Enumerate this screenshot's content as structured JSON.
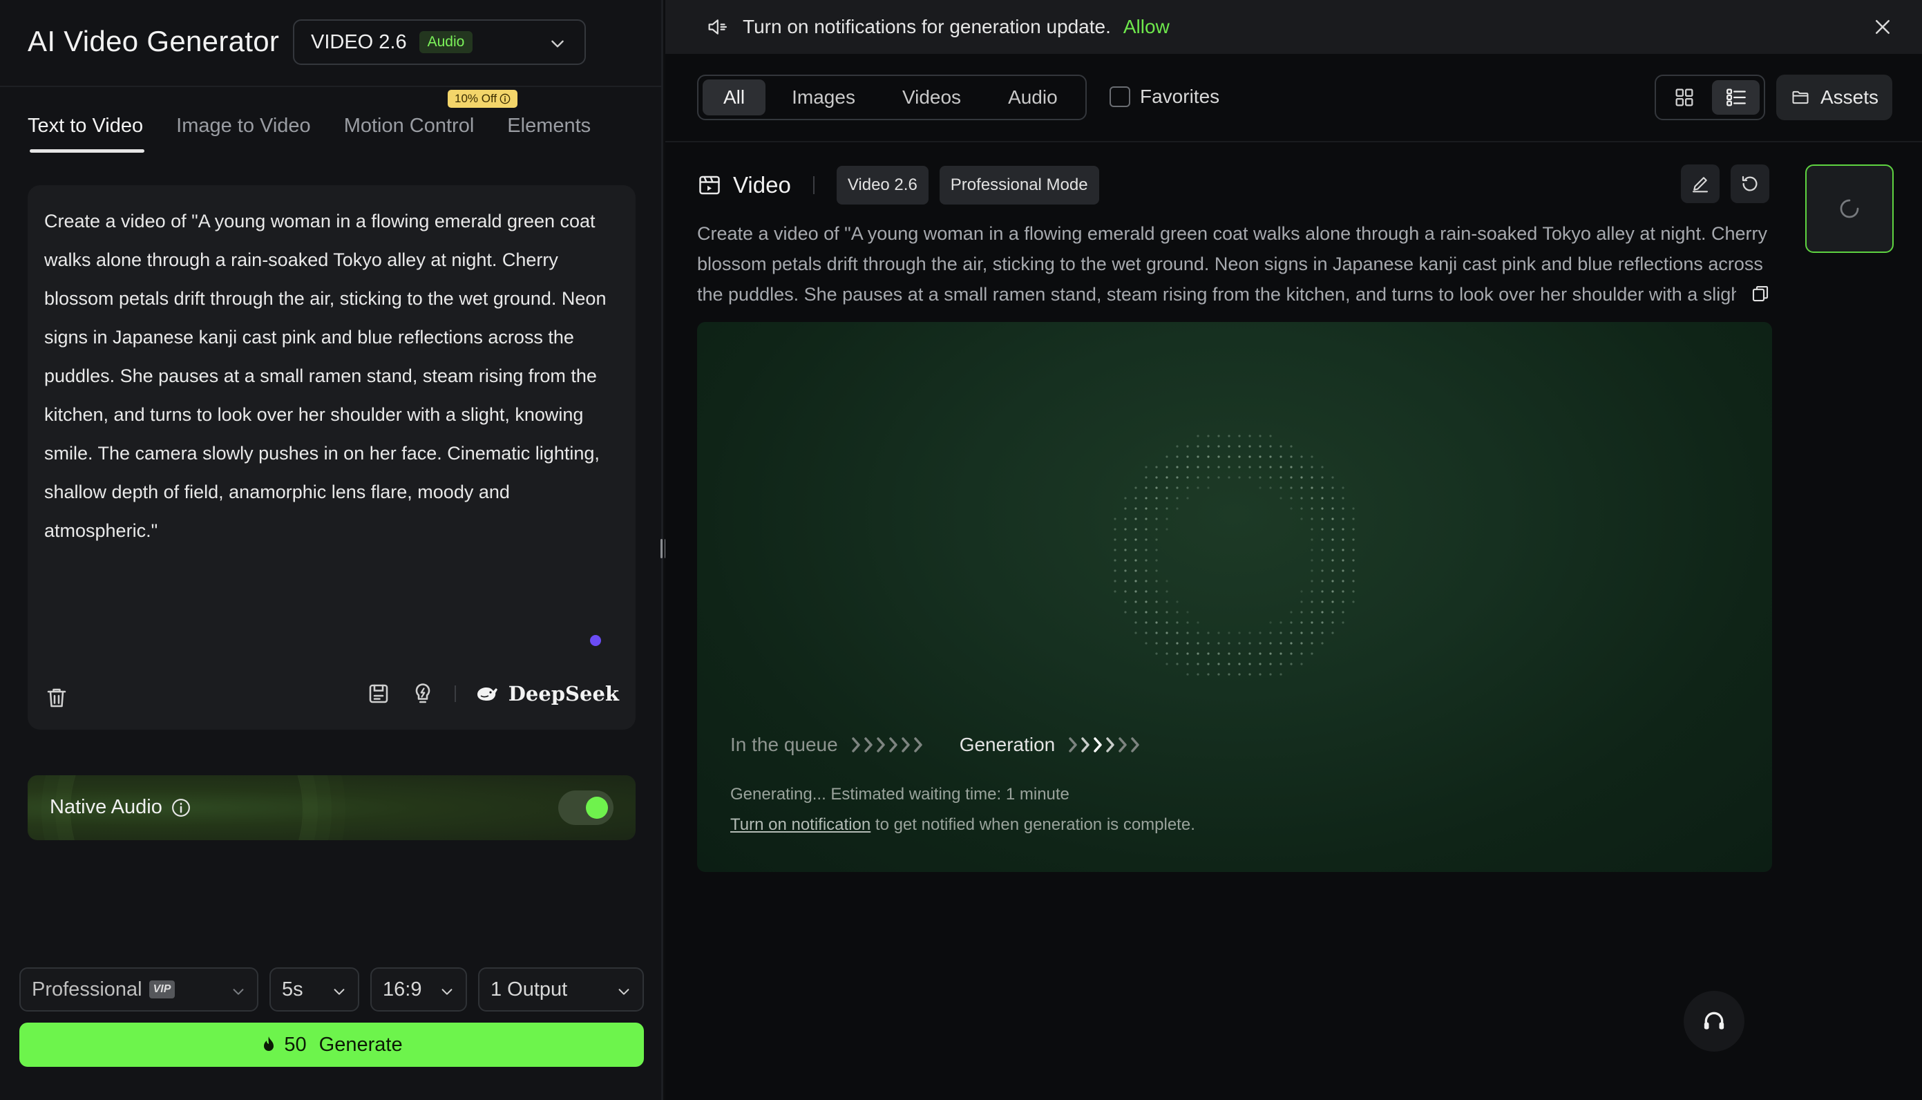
{
  "app": {
    "title": "AI Video Generator",
    "model": "VIDEO 2.6",
    "model_badge": "Audio"
  },
  "tabs": [
    {
      "label": "Text to Video",
      "active": true
    },
    {
      "label": "Image to Video",
      "active": false
    },
    {
      "label": "Motion Control",
      "active": false
    },
    {
      "label": "Elements",
      "active": false
    }
  ],
  "discount_badge": "10% Off",
  "prompt": {
    "text": "Create a video of \"A young woman in a flowing emerald green coat walks alone through a rain-soaked Tokyo alley at night. Cherry blossom petals drift through the air, sticking to the wet ground. Neon signs in Japanese kanji cast pink and blue reflections across the puddles. She pauses at a small ramen stand, steam rising from the kitchen, and turns to look over her shoulder with a slight, knowing smile. The camera slowly pushes in on her face. Cinematic lighting, shallow depth of field, anamorphic lens flare, moody and atmospheric.\"",
    "deepseek_label": "DeepSeek"
  },
  "native_audio": {
    "label": "Native Audio",
    "enabled": true
  },
  "options": {
    "mode": "Professional",
    "mode_badge": "VIP",
    "duration": "5s",
    "ratio": "16:9",
    "outputs": "1 Output"
  },
  "generate": {
    "cost": "50",
    "label": "Generate"
  },
  "notification": {
    "message": "Turn on notifications for generation update.",
    "action": "Allow"
  },
  "filters": {
    "tabs": [
      {
        "label": "All",
        "active": true
      },
      {
        "label": "Images",
        "active": false
      },
      {
        "label": "Videos",
        "active": false
      },
      {
        "label": "Audio",
        "active": false
      }
    ],
    "favorites_label": "Favorites",
    "assets_label": "Assets"
  },
  "item": {
    "type_label": "Video",
    "model_chip": "Video 2.6",
    "mode_chip": "Professional Mode",
    "description": "Create a video of \"A young woman in a flowing emerald green coat walks alone through a rain-soaked Tokyo alley at night. Cherry blossom petals drift through the air, sticking to the wet ground. Neon signs in Japanese kanji cast pink and blue reflections across the puddles. She pauses at a small ramen stand, steam rising from the kitchen, and turns to look over her shoulder with a slight, knowing smile. The camera slowly pushes in on her face. Cinematic lighting, shallow depth of field, anamorphic lens flare, moody and atmospheric.\"",
    "queue_label": "In the queue",
    "generation_label": "Generation",
    "status_message": "Generating... Estimated waiting time: 1 minute",
    "notify_link": "Turn on notification",
    "notify_suffix": " to get notified when generation is complete."
  },
  "colors": {
    "accent": "#6df44c",
    "panel": "#121316",
    "background": "#0b0c0e"
  }
}
